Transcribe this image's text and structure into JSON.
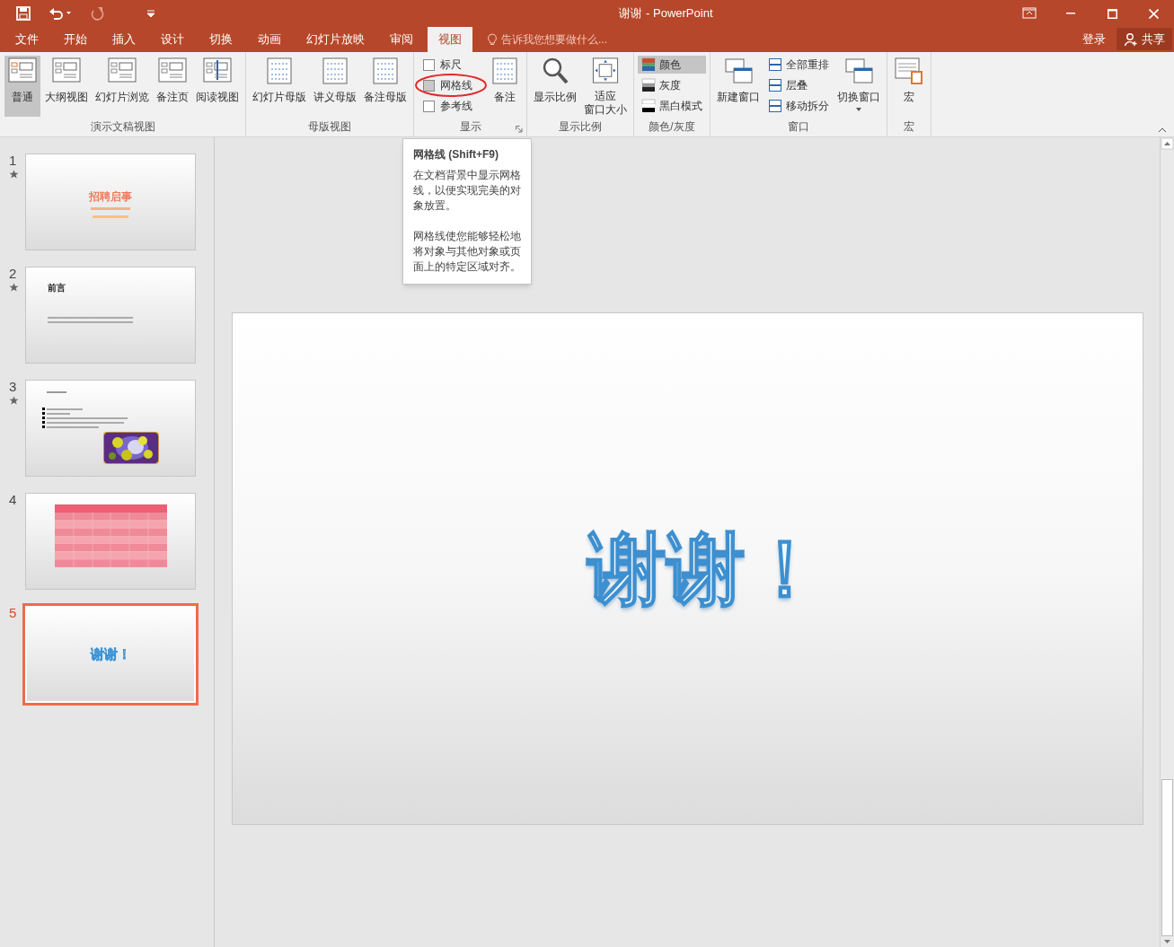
{
  "window": {
    "title": "谢谢 - PowerPoint"
  },
  "tabs": [
    {
      "label": "文件",
      "selected": false
    },
    {
      "label": "开始",
      "selected": false
    },
    {
      "label": "插入",
      "selected": false
    },
    {
      "label": "设计",
      "selected": false
    },
    {
      "label": "切换",
      "selected": false
    },
    {
      "label": "动画",
      "selected": false
    },
    {
      "label": "幻灯片放映",
      "selected": false
    },
    {
      "label": "审阅",
      "selected": false
    },
    {
      "label": "视图",
      "selected": true
    }
  ],
  "tell_me": {
    "placeholder": "告诉我您想要做什么..."
  },
  "account": {
    "sign_in": "登录",
    "share": "共享"
  },
  "ribbon_groups": [
    {
      "label": "演示文稿视图",
      "items": [
        {
          "kind": "large",
          "label": "普通",
          "selected": true
        },
        {
          "kind": "large",
          "label": "大纲视图",
          "selected": false
        },
        {
          "kind": "large",
          "label": "幻灯片浏览",
          "selected": false
        },
        {
          "kind": "large",
          "label": "备注页",
          "selected": false
        },
        {
          "kind": "large",
          "label": "阅读视图",
          "selected": false
        }
      ]
    },
    {
      "label": "母版视图",
      "items": [
        {
          "kind": "large",
          "label": "幻灯片母版",
          "selected": false
        },
        {
          "kind": "large",
          "label": "讲义母版",
          "selected": false
        },
        {
          "kind": "large",
          "label": "备注母版",
          "selected": false
        }
      ]
    },
    {
      "label": "显示",
      "launcher": true,
      "items": [
        {
          "kind": "checks",
          "options": [
            {
              "label": "标尺",
              "checked": false,
              "highlighted": false
            },
            {
              "label": "网格线",
              "checked": false,
              "highlighted": true
            },
            {
              "label": "参考线",
              "checked": false,
              "highlighted": false
            }
          ]
        },
        {
          "kind": "large",
          "label": "备注",
          "selected": false
        }
      ]
    },
    {
      "label": "显示比例",
      "items": [
        {
          "kind": "large",
          "label": "显示比例",
          "selected": false
        },
        {
          "kind": "large",
          "lines": [
            "适应",
            "窗口大小"
          ],
          "selected": false
        }
      ]
    },
    {
      "label": "颜色/灰度",
      "items": [
        {
          "kind": "smalls",
          "options": [
            {
              "label": "颜色",
              "selected": true
            },
            {
              "label": "灰度",
              "selected": false
            },
            {
              "label": "黑白模式",
              "selected": false
            }
          ]
        }
      ]
    },
    {
      "label": "窗口",
      "items": [
        {
          "kind": "large",
          "label": "新建窗口",
          "selected": false
        },
        {
          "kind": "smalls",
          "options": [
            {
              "label": "全部重排",
              "selected": false
            },
            {
              "label": "层叠",
              "selected": false
            },
            {
              "label": "移动拆分",
              "selected": false
            }
          ]
        },
        {
          "kind": "large",
          "label": "切换窗口",
          "selected": false,
          "dropdown": true
        }
      ]
    },
    {
      "label": "宏",
      "items": [
        {
          "kind": "large",
          "label": "宏",
          "selected": false
        }
      ]
    }
  ],
  "tooltip": {
    "title": "网格线 (Shift+F9)",
    "paragraphs": [
      "在文档背景中显示网格线，以便实现完美的对象放置。",
      "网格线使您能够轻松地将对象与其他对象或页面上的特定区域对齐。"
    ]
  },
  "slides": [
    {
      "number": "1",
      "starred": true,
      "selected": false,
      "kind": "title",
      "title": "招聘启事"
    },
    {
      "number": "2",
      "starred": true,
      "selected": false,
      "kind": "text",
      "title": "前言"
    },
    {
      "number": "3",
      "starred": true,
      "selected": false,
      "kind": "bullets"
    },
    {
      "number": "4",
      "starred": false,
      "selected": false,
      "kind": "table"
    },
    {
      "number": "5",
      "starred": false,
      "selected": true,
      "kind": "thanks",
      "title": "谢谢！"
    }
  ],
  "current_slide": {
    "title": "谢谢！"
  }
}
